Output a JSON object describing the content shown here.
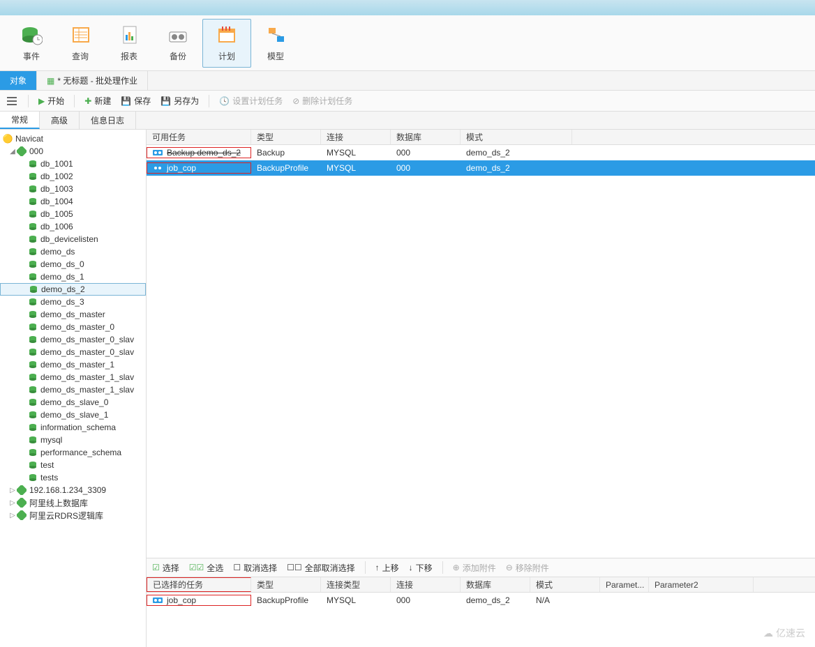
{
  "toolbar": [
    {
      "label": "事件",
      "icon": "event"
    },
    {
      "label": "查询",
      "icon": "query"
    },
    {
      "label": "报表",
      "icon": "report"
    },
    {
      "label": "备份",
      "icon": "backup"
    },
    {
      "label": "计划",
      "icon": "schedule",
      "active": true
    },
    {
      "label": "模型",
      "icon": "model"
    }
  ],
  "tabs": [
    {
      "label": "对象",
      "active": true
    },
    {
      "label": "* 无标题 - 批处理作业",
      "active": false
    }
  ],
  "actions": {
    "start": "开始",
    "new": "新建",
    "save": "保存",
    "saveas": "另存为",
    "set_schedule": "设置计划任务",
    "delete_schedule": "删除计划任务"
  },
  "subtabs": [
    {
      "label": "常规",
      "active": true
    },
    {
      "label": "高级",
      "active": false
    },
    {
      "label": "信息日志",
      "active": false
    }
  ],
  "tree": {
    "root": "Navicat",
    "conn": "000",
    "databases": [
      "db_1001",
      "db_1002",
      "db_1003",
      "db_1004",
      "db_1005",
      "db_1006",
      "db_devicelisten",
      "demo_ds",
      "demo_ds_0",
      "demo_ds_1",
      "demo_ds_2",
      "demo_ds_3",
      "demo_ds_master",
      "demo_ds_master_0",
      "demo_ds_master_0_slav",
      "demo_ds_master_0_slav",
      "demo_ds_master_1",
      "demo_ds_master_1_slav",
      "demo_ds_master_1_slav",
      "demo_ds_slave_0",
      "demo_ds_slave_1",
      "information_schema",
      "mysql",
      "performance_schema",
      "test",
      "tests"
    ],
    "selected_db": "demo_ds_2",
    "other_conns": [
      "192.168.1.234_3309",
      "阿里线上数据库",
      "阿里云RDRS逻辑库"
    ]
  },
  "available_tasks": {
    "headers": {
      "task": "可用任务",
      "type": "类型",
      "conn": "连接",
      "db": "数据库",
      "mode": "模式"
    },
    "rows": [
      {
        "task": "Backup demo_ds_2",
        "type": "Backup",
        "conn": "MYSQL",
        "db": "000",
        "mode": "demo_ds_2",
        "strike": true,
        "redbox": true
      },
      {
        "task": "job_cop",
        "type": "BackupProfile",
        "conn": "MYSQL",
        "db": "000",
        "mode": "demo_ds_2",
        "selected": true,
        "redbox": true
      }
    ]
  },
  "sel_toolbar": {
    "select": "选择",
    "select_all": "全选",
    "deselect": "取消选择",
    "deselect_all": "全部取消选择",
    "up": "上移",
    "down": "下移",
    "add_attach": "添加附件",
    "remove_attach": "移除附件"
  },
  "selected_tasks": {
    "headers": {
      "task": "已选择的任务",
      "type": "类型",
      "conn_type": "连接类型",
      "conn": "连接",
      "db": "数据库",
      "mode": "模式",
      "p1": "Paramet...",
      "p2": "Parameter2"
    },
    "rows": [
      {
        "task": "job_cop",
        "type": "BackupProfile",
        "conn_type": "MYSQL",
        "conn": "000",
        "db": "demo_ds_2",
        "mode": "N/A",
        "p1": "",
        "p2": ""
      }
    ]
  },
  "watermark": "亿速云"
}
